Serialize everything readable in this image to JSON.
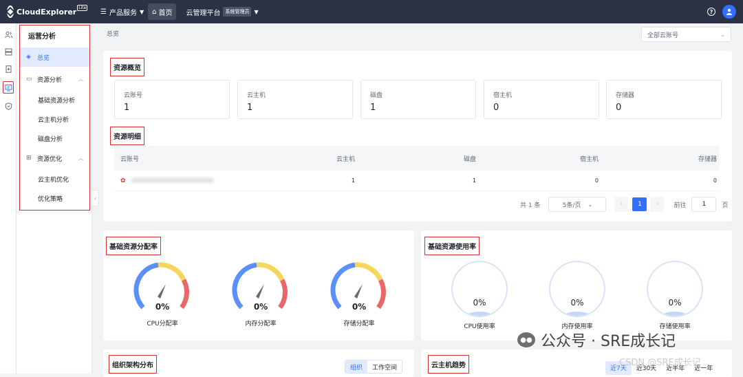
{
  "topbar": {
    "logo_text": "CloudExplorer",
    "logo_badge": "Lite",
    "menu": [
      {
        "label": "产品服务",
        "icon": "list-icon"
      },
      {
        "label": "首页",
        "icon": "home-icon"
      },
      {
        "label": "云管理平台",
        "badge": "系统管理员"
      }
    ],
    "help_icon": "?"
  },
  "sidebar": {
    "title": "运营分析",
    "items": [
      {
        "label": "总览"
      },
      {
        "label": "资源分析"
      },
      {
        "label": "基础资源分析"
      },
      {
        "label": "云主机分析"
      },
      {
        "label": "磁盘分析"
      },
      {
        "label": "资源优化"
      },
      {
        "label": "云主机优化"
      },
      {
        "label": "优化策略"
      }
    ]
  },
  "main": {
    "breadcrumb": "总览",
    "account_select": "全部云账号",
    "overview": {
      "title": "资源概览",
      "stats": [
        {
          "label": "云账号",
          "value": "1"
        },
        {
          "label": "云主机",
          "value": "1"
        },
        {
          "label": "磁盘",
          "value": "1"
        },
        {
          "label": "宿主机",
          "value": "0"
        },
        {
          "label": "存储器",
          "value": "0"
        }
      ]
    },
    "detail": {
      "title": "资源明细",
      "columns": [
        "云账号",
        "云主机",
        "磁盘",
        "宿主机",
        "存储器"
      ],
      "rows": [
        [
          "1",
          "1",
          "0",
          "0"
        ]
      ],
      "pager": {
        "total": "共 1 条",
        "page_size": "5条/页",
        "current": "1",
        "goto_label": "前往",
        "goto_value": "1",
        "page_unit": "页"
      }
    },
    "allocation": {
      "title": "基础资源分配率",
      "gauges": [
        {
          "label": "CPU分配率",
          "value": "0%"
        },
        {
          "label": "内存分配率",
          "value": "0%"
        },
        {
          "label": "存储分配率",
          "value": "0%"
        }
      ]
    },
    "usage": {
      "title": "基础资源使用率",
      "balls": [
        {
          "label": "CPU使用率",
          "value": "0%"
        },
        {
          "label": "内存使用率",
          "value": "0%"
        },
        {
          "label": "存储使用率",
          "value": "0%"
        }
      ]
    },
    "org": {
      "title": "组织架构分布",
      "tabs": [
        "组织",
        "工作空间"
      ]
    },
    "trend": {
      "title": "云主机趋势",
      "tabs": [
        "近7天",
        "近30天",
        "近半年",
        "近一年"
      ]
    }
  },
  "watermark": {
    "text": "公众号 · SRE成长记",
    "csdn": "CSDN @SRE成长记"
  },
  "colors": {
    "accent": "#3370ff",
    "topbar": "#2b3245",
    "highlight": "#d62e2e"
  }
}
